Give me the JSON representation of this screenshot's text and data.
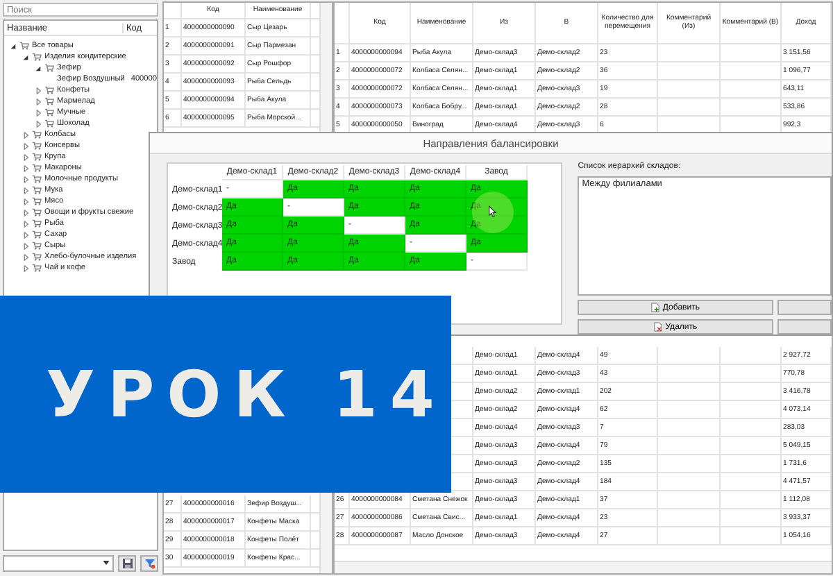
{
  "sidebar": {
    "search": {
      "placeholder": "Поиск"
    },
    "columns": [
      "Название",
      "Код"
    ],
    "tree": [
      {
        "label": "Все товары",
        "expanded": true,
        "children": [
          {
            "label": "Изделия кондитерские",
            "expanded": true,
            "children": [
              {
                "label": "Зефир",
                "expanded": true,
                "children": [
                  {
                    "label": "Зефир Воздушный",
                    "code": "400000"
                  }
                ]
              },
              {
                "label": "Конфеты",
                "expanded": false
              },
              {
                "label": "Мармелад",
                "expanded": false
              },
              {
                "label": "Мучные",
                "expanded": false
              },
              {
                "label": "Шоколад",
                "expanded": false
              }
            ]
          },
          {
            "label": "Колбасы",
            "expanded": false
          },
          {
            "label": "Консервы",
            "expanded": false
          },
          {
            "label": "Крупа",
            "expanded": false
          },
          {
            "label": "Макароны",
            "expanded": false
          },
          {
            "label": "Молочные продукты",
            "expanded": false
          },
          {
            "label": "Мука",
            "expanded": false
          },
          {
            "label": "Мясо",
            "expanded": false
          },
          {
            "label": "Овощи и фрукты свежие",
            "expanded": false
          },
          {
            "label": "Рыба",
            "expanded": false
          },
          {
            "label": "Сахар",
            "expanded": false
          },
          {
            "label": "Сыры",
            "expanded": false
          },
          {
            "label": "Хлебо-булочные изделия",
            "expanded": false
          },
          {
            "label": "Чай и кофе",
            "expanded": false
          }
        ]
      }
    ]
  },
  "products_table": {
    "columns": [
      "Код",
      "Наименование"
    ],
    "rows_top": [
      {
        "n": "1",
        "code": "4000000000090",
        "name": "Сыр Цезарь"
      },
      {
        "n": "2",
        "code": "4000000000091",
        "name": "Сыр Пармезан"
      },
      {
        "n": "3",
        "code": "4000000000092",
        "name": "Сыр Рошфор"
      },
      {
        "n": "4",
        "code": "4000000000093",
        "name": "Рыба Сельдь"
      },
      {
        "n": "5",
        "code": "4000000000094",
        "name": "Рыба Акула"
      },
      {
        "n": "6",
        "code": "4000000000095",
        "name": "Рыба Морской..."
      }
    ],
    "rows_bottom": [
      {
        "n": "27",
        "code": "4000000000016",
        "name": "Зефир Воздуш..."
      },
      {
        "n": "28",
        "code": "4000000000017",
        "name": "Конфеты Маска"
      },
      {
        "n": "29",
        "code": "4000000000018",
        "name": "Конфеты Полёт"
      },
      {
        "n": "30",
        "code": "4000000000019",
        "name": "Конфеты Крас..."
      }
    ]
  },
  "transfers_table": {
    "columns": [
      "Код",
      "Наименование",
      "Из",
      "В",
      "Количество для перемещения",
      "Комментарий (Из)",
      "Комментарий (В)",
      "Доход"
    ],
    "rows_top": [
      {
        "n": "1",
        "code": "4000000000094",
        "name": "Рыба Акула",
        "from": "Демо-склад3",
        "to": "Демо-склад2",
        "qty": "23",
        "income": "3 151,56"
      },
      {
        "n": "2",
        "code": "4000000000072",
        "name": "Колбаса Селян...",
        "from": "Демо-склад1",
        "to": "Демо-склад2",
        "qty": "36",
        "income": "1 096,77"
      },
      {
        "n": "3",
        "code": "4000000000072",
        "name": "Колбаса Селян...",
        "from": "Демо-склад1",
        "to": "Демо-склад3",
        "qty": "19",
        "income": "643,11"
      },
      {
        "n": "4",
        "code": "4000000000073",
        "name": "Колбаса Бобру...",
        "from": "Демо-склад1",
        "to": "Демо-склад2",
        "qty": "28",
        "income": "533,86"
      },
      {
        "n": "5",
        "code": "4000000000050",
        "name": "Виноград",
        "from": "Демо-склад4",
        "to": "Демо-склад3",
        "qty": "6",
        "income": "992,3"
      }
    ],
    "rows_bottom": [
      {
        "from": "Демо-склад1",
        "to": "Демо-склад4",
        "qty": "49",
        "income": "2 927,72"
      },
      {
        "from": "Демо-склад1",
        "to": "Демо-склад3",
        "qty": "43",
        "income": "770,78"
      },
      {
        "from": "Демо-склад2",
        "to": "Демо-склад1",
        "qty": "202",
        "income": "3 416,78"
      },
      {
        "from": "Демо-склад2",
        "to": "Демо-склад4",
        "qty": "62",
        "income": "4 073,14"
      },
      {
        "from": "Демо-склад4",
        "to": "Демо-склад3",
        "qty": "7",
        "income": "283,03"
      },
      {
        "from": "Демо-склад3",
        "to": "Демо-склад4",
        "qty": "79",
        "income": "5 049,15"
      },
      {
        "from": "Демо-склад3",
        "to": "Демо-склад2",
        "qty": "135",
        "income": "1 731,6"
      },
      {
        "from": "Демо-склад3",
        "to": "Демо-склад4",
        "qty": "184",
        "income": "4 471,57"
      },
      {
        "n": "26",
        "code": "4000000000084",
        "name": "Сметана Снежок",
        "from": "Демо-склад3",
        "to": "Демо-склад1",
        "qty": "37",
        "income": "1 112,08"
      },
      {
        "n": "27",
        "code": "4000000000086",
        "name": "Сметана Свис...",
        "from": "Демо-склад1",
        "to": "Демо-склад4",
        "qty": "23",
        "income": "3 933,37"
      },
      {
        "n": "28",
        "code": "4000000000087",
        "name": "Масло Донское",
        "from": "Демо-склад3",
        "to": "Демо-склад4",
        "qty": "27",
        "income": "1 054,16"
      }
    ]
  },
  "dialog": {
    "title": "Направления балансировки",
    "matrix": {
      "columns": [
        "Демо-склад1",
        "Демо-склад2",
        "Демо-склад3",
        "Демо-склад4",
        "Завод"
      ],
      "rows": [
        {
          "label": "Демо-склад1",
          "cells": [
            {
              "text": "-",
              "allowed": false
            },
            {
              "text": "Да",
              "allowed": true
            },
            {
              "text": "Да",
              "allowed": true
            },
            {
              "text": "Да",
              "allowed": true
            },
            {
              "text": "Да",
              "allowed": true
            }
          ]
        },
        {
          "label": "Демо-склад2",
          "cells": [
            {
              "text": "Да",
              "allowed": true
            },
            {
              "text": "-",
              "allowed": false
            },
            {
              "text": "Да",
              "allowed": true
            },
            {
              "text": "Да",
              "allowed": true
            },
            {
              "text": "Да",
              "allowed": true
            }
          ]
        },
        {
          "label": "Демо-склад3",
          "cells": [
            {
              "text": "Да",
              "allowed": true
            },
            {
              "text": "Да",
              "allowed": true
            },
            {
              "text": "-",
              "allowed": false
            },
            {
              "text": "Да",
              "allowed": true
            },
            {
              "text": "Да",
              "allowed": true
            }
          ]
        },
        {
          "label": "Демо-склад4",
          "cells": [
            {
              "text": "Да",
              "allowed": true
            },
            {
              "text": "Да",
              "allowed": true
            },
            {
              "text": "Да",
              "allowed": true
            },
            {
              "text": "-",
              "allowed": false
            },
            {
              "text": "Да",
              "allowed": true
            }
          ]
        },
        {
          "label": "Завод",
          "cells": [
            {
              "text": "Да",
              "allowed": true
            },
            {
              "text": "Да",
              "allowed": true
            },
            {
              "text": "Да",
              "allowed": true
            },
            {
              "text": "Да",
              "allowed": true
            },
            {
              "text": "-",
              "allowed": false
            }
          ]
        }
      ]
    },
    "list_label": "Список иерархий складов:",
    "list_items": [
      {
        "label": "Между филиалами",
        "selected": false
      }
    ],
    "buttons": [
      {
        "label": "Добавить",
        "kind": "add"
      },
      {
        "label": "Удалить",
        "kind": "delete"
      }
    ]
  },
  "banner": {
    "text": "УРОК 14"
  }
}
